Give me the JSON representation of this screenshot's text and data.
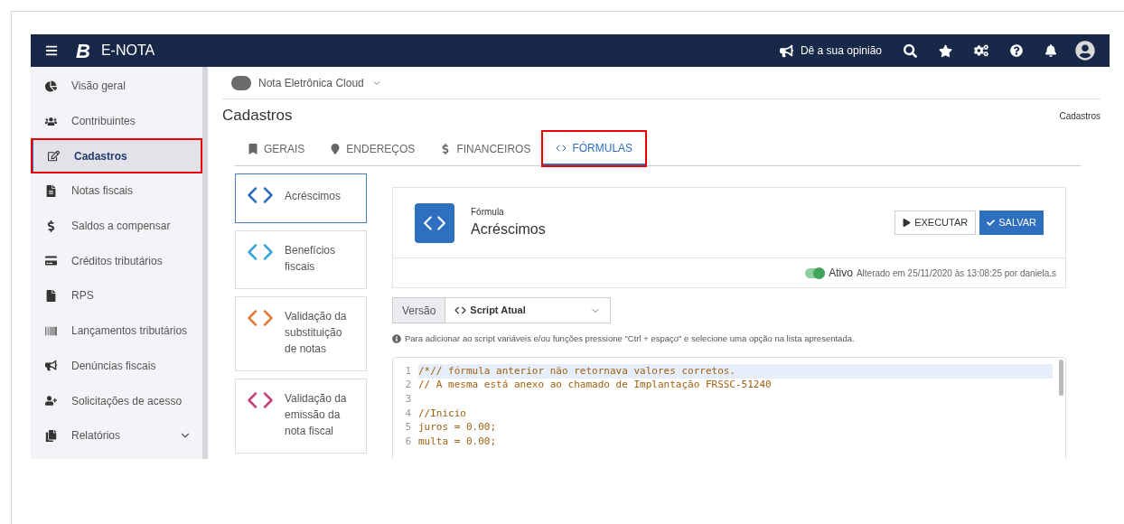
{
  "header": {
    "app_name": "E-NOTA",
    "logo_letter": "B",
    "feedback": "Dê a sua opinião"
  },
  "sidebar": {
    "items": [
      {
        "label": "Visão geral",
        "selected": false,
        "highlighted": false,
        "expandable": false
      },
      {
        "label": "Contribuintes",
        "selected": false,
        "highlighted": false,
        "expandable": false
      },
      {
        "label": "Cadastros",
        "selected": true,
        "highlighted": true,
        "expandable": false
      },
      {
        "label": "Notas fiscais",
        "selected": false,
        "highlighted": false,
        "expandable": false
      },
      {
        "label": "Saldos a compensar",
        "selected": false,
        "highlighted": false,
        "expandable": false
      },
      {
        "label": "Créditos tributários",
        "selected": false,
        "highlighted": false,
        "expandable": false
      },
      {
        "label": "RPS",
        "selected": false,
        "highlighted": false,
        "expandable": false
      },
      {
        "label": "Lançamentos tributários",
        "selected": false,
        "highlighted": false,
        "expandable": false
      },
      {
        "label": "Denúncias fiscais",
        "selected": false,
        "highlighted": false,
        "expandable": false
      },
      {
        "label": "Solicitações de acesso",
        "selected": false,
        "highlighted": false,
        "expandable": false
      },
      {
        "label": "Relatórios",
        "selected": false,
        "highlighted": false,
        "expandable": true
      }
    ]
  },
  "org": {
    "name": "Nota Eletrônica Cloud"
  },
  "page": {
    "title": "Cadastros",
    "breadcrumb": "Cadastros"
  },
  "tabs": [
    {
      "label": "GERAIS",
      "selected": false,
      "highlighted": false
    },
    {
      "label": "ENDEREÇOS",
      "selected": false,
      "highlighted": false
    },
    {
      "label": "FINANCEIROS",
      "selected": false,
      "highlighted": false
    },
    {
      "label": "FÓRMULAS",
      "selected": true,
      "highlighted": true
    }
  ],
  "formulas": [
    {
      "label": "Acréscimos",
      "color": "#2f6fbf",
      "selected": true
    },
    {
      "label": "Benefícios fiscais",
      "color": "#3aa7d8",
      "selected": false
    },
    {
      "label": "Validação da substituição de notas",
      "color": "#e8783a",
      "selected": false
    },
    {
      "label": "Validação da emissão da nota fiscal",
      "color": "#c8407e",
      "selected": false
    }
  ],
  "formula": {
    "caption": "Fórmula",
    "name": "Acréscimos",
    "run": "EXECUTAR",
    "save": "SALVAR",
    "active": true,
    "active_label": "Ativo",
    "changed": "Alterado em 25/11/2020 às 13:08:25 por daniela.s"
  },
  "version": {
    "label": "Versão",
    "value": "Script Atual"
  },
  "hint": "Para adicionar ao script variáveis e/ou funções pressione \"Ctrl + espaço\" e selecione uma opção na lista apresentada.",
  "code_lines": [
    {
      "number": "1",
      "text": "/*// fórmula anterior não retornava valores corretos.",
      "selected": true
    },
    {
      "number": "2",
      "text": "// A mesma está anexo ao chamado de Implantação FRSSC-51240",
      "selected": false
    },
    {
      "number": "3",
      "selected": false
    },
    {
      "number": "4",
      "text": "//Inicio",
      "selected": false
    },
    {
      "number": "5",
      "text": "juros = 0.00;",
      "selected": false
    },
    {
      "number": "6",
      "text": "multa = 0.00;",
      "selected": false
    }
  ]
}
